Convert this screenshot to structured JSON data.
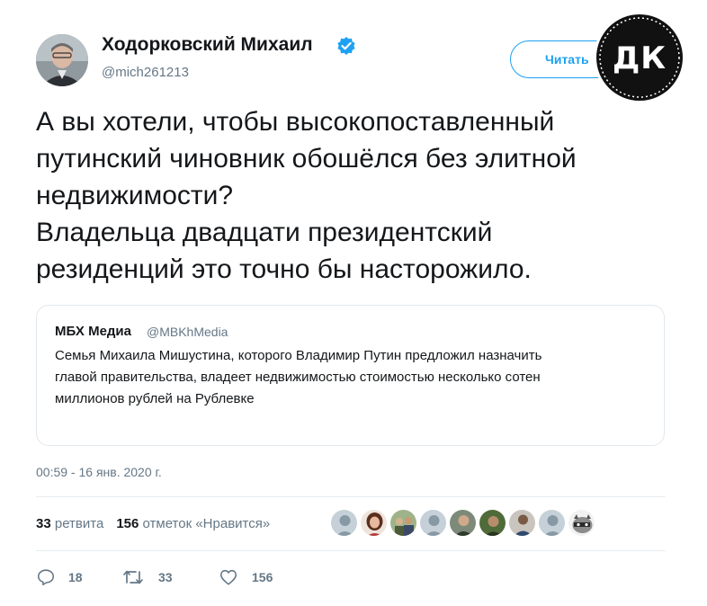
{
  "author": {
    "name": "Ходорковский Михаил",
    "handle": "@mich261213"
  },
  "follow_button": {
    "label": "Читать"
  },
  "logo": {
    "text": "ДК"
  },
  "tweet_lines": [
    "А вы хотели, чтобы высокопоставленный",
    "путинский чиновник обошёлся без элитной",
    "недвижимости?",
    "Владельца двадцати президентский",
    "резиденций это точно бы насторожило."
  ],
  "quote": {
    "name": "МБХ Медиа",
    "handle": "@MBKhMedia",
    "lines": [
      "Семья Михаила Мишустина, которого Владимир Путин предложил назначить",
      "главой правительства, владеет недвижимостью стоимостью несколько сотен",
      "миллионов рублей на Рублевке"
    ]
  },
  "timestamp": "00:59 - 16 янв. 2020 г.",
  "stats": {
    "retweets_count": "33",
    "retweets_label": "ретвита",
    "likes_count": "156",
    "likes_label": "отметок «Нравится»"
  },
  "actions": {
    "reply_count": "18",
    "retweet_count": "33",
    "like_count": "156"
  },
  "colors": {
    "accent": "#1da1f2",
    "secondary_text": "#657786",
    "border": "#e1e8ed"
  },
  "likers": [
    "avatar-default",
    "avatar-woman",
    "avatar-group",
    "avatar-default",
    "avatar-man",
    "avatar-man-outdoor",
    "avatar-man-dark",
    "avatar-default",
    "avatar-raccoon"
  ]
}
